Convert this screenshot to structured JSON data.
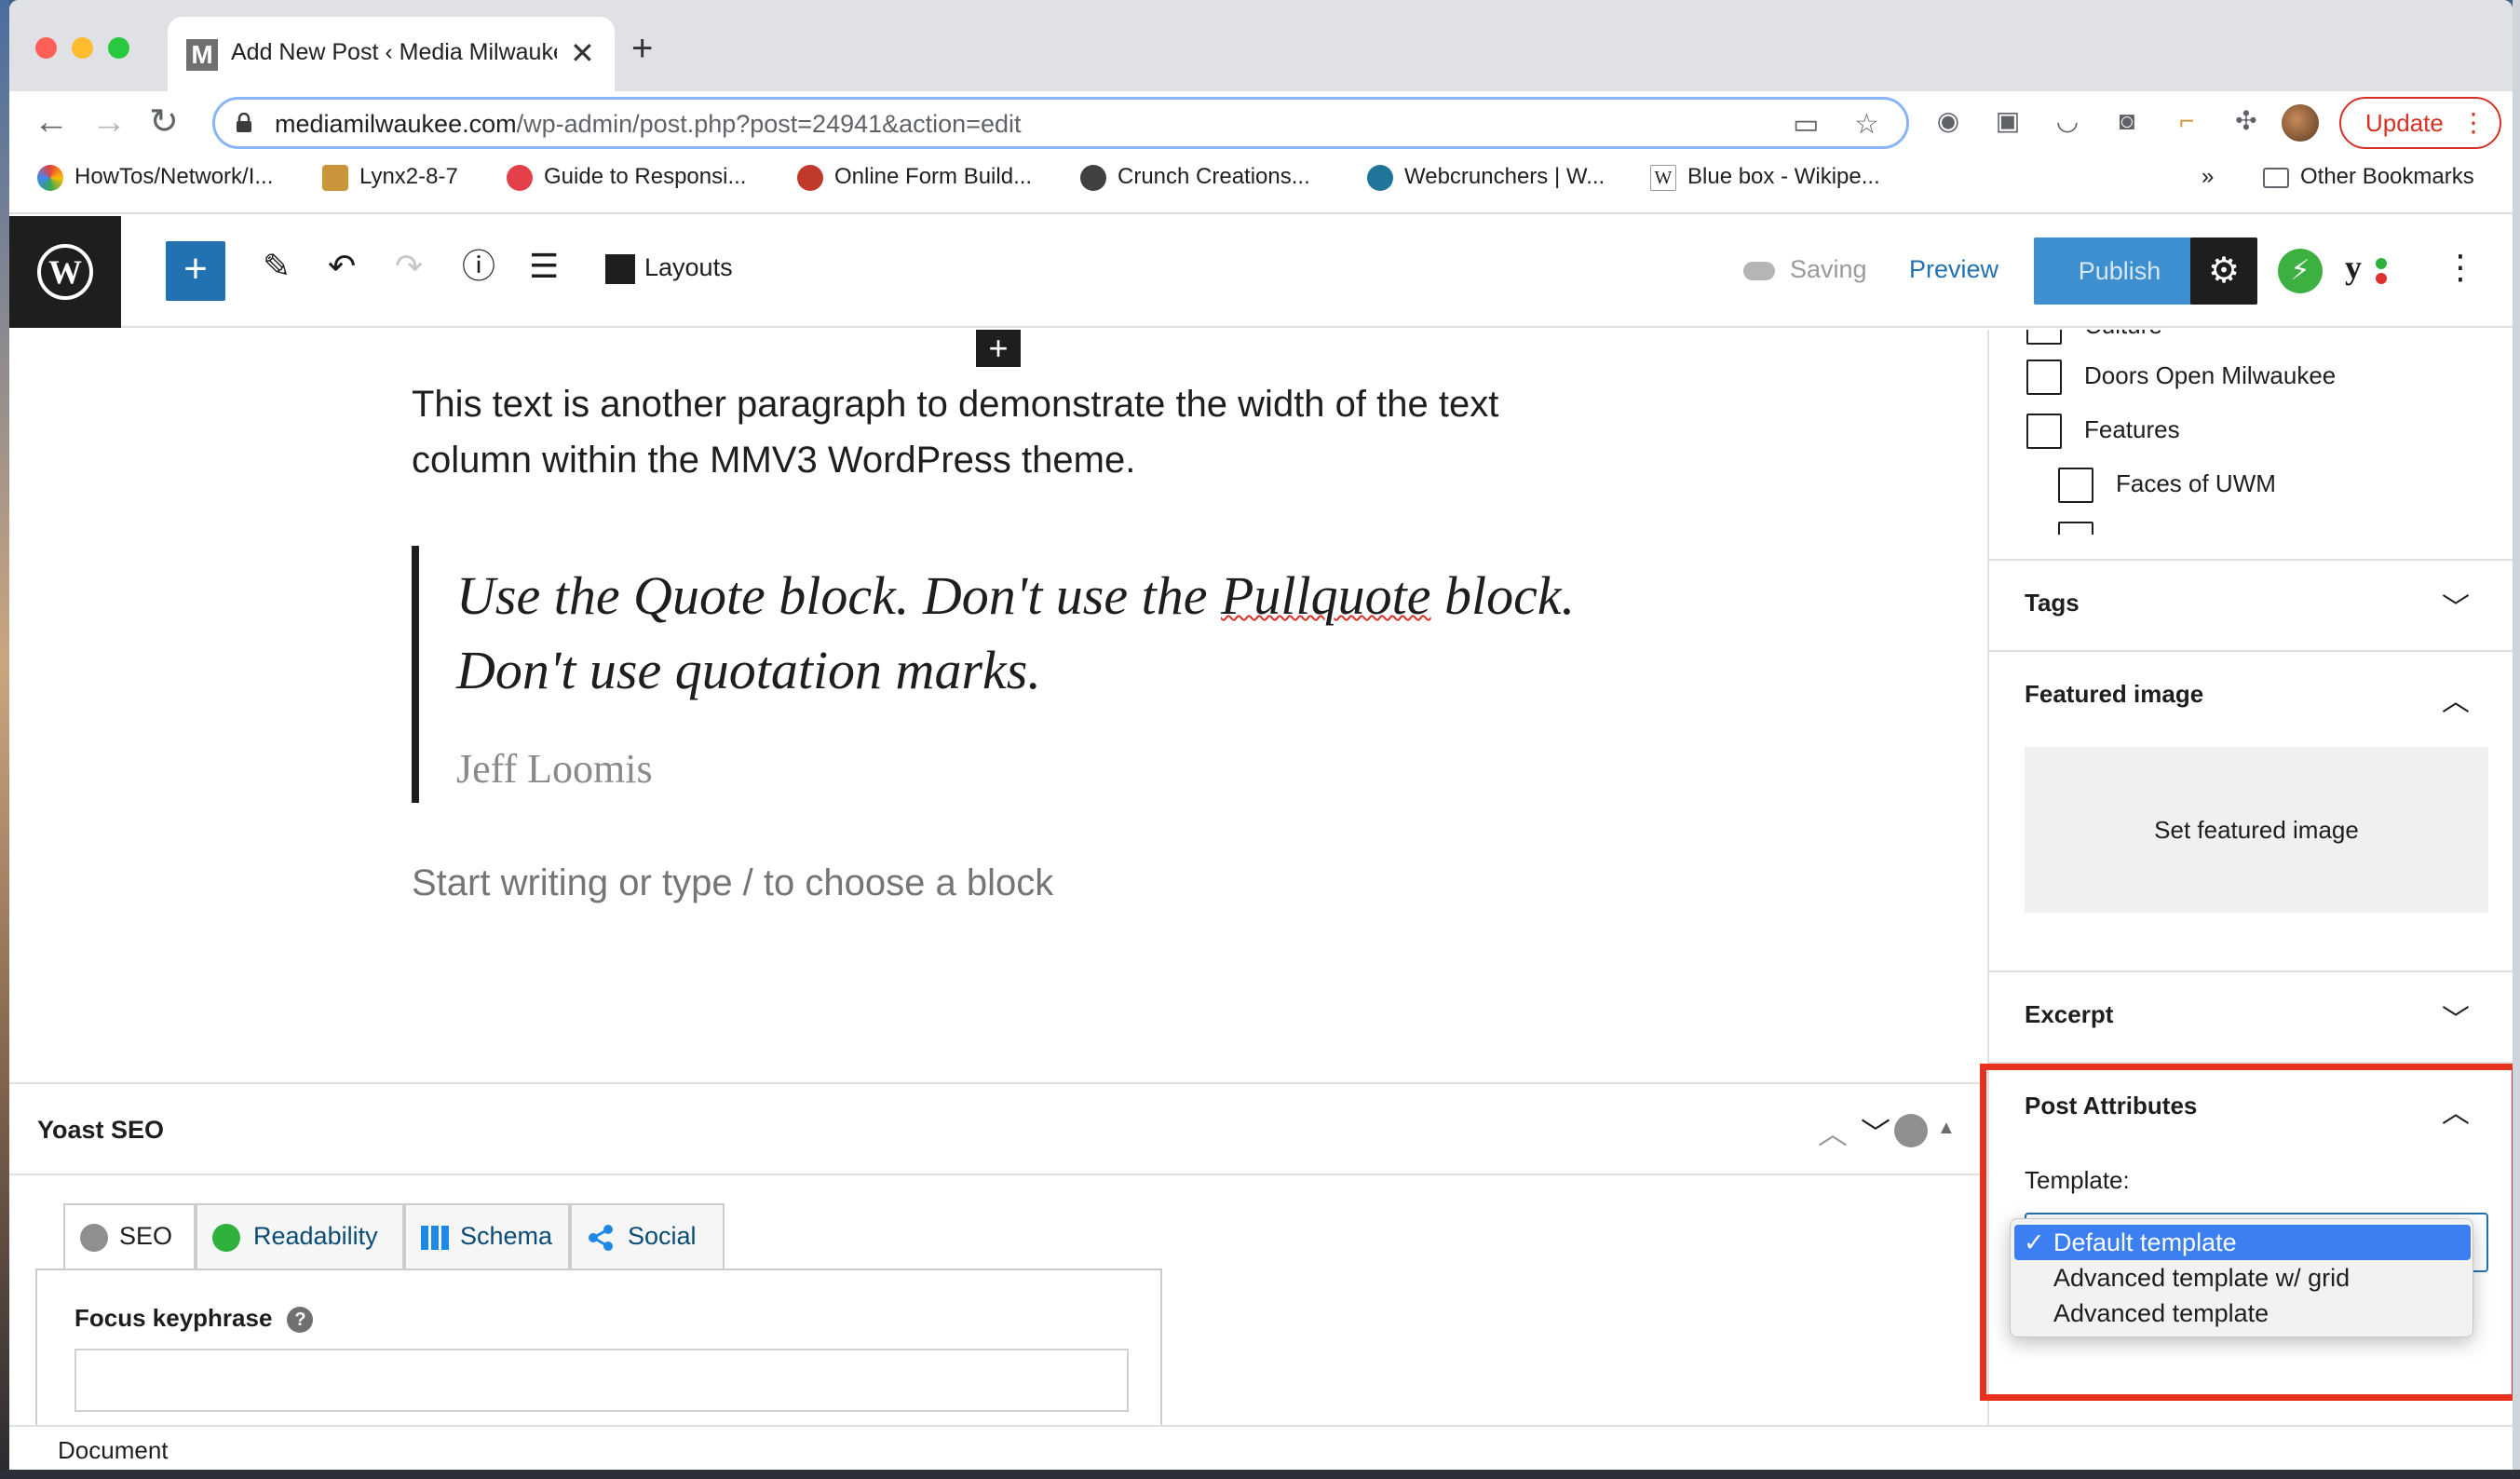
{
  "browser": {
    "tab_title": "Add New Post ‹ Media Milwaukee",
    "tab_favicon": "M",
    "tab_close": "✕",
    "new_tab": "+",
    "url_domain": "mediamilwaukee.com",
    "url_path": "/wp-admin/post.php?post=24941&action=edit",
    "update_label": "Update",
    "bookmarks": [
      {
        "label": "HowTos/Network/I...",
        "icon": "puzzle-colorful-icon"
      },
      {
        "label": "Lynx2-8-7",
        "icon": "lynx-icon"
      },
      {
        "label": "Guide to Responsi...",
        "icon": "guide-icon"
      },
      {
        "label": "Online Form Build...",
        "icon": "form-icon"
      },
      {
        "label": "Crunch Creations...",
        "icon": "crunch-icon"
      },
      {
        "label": "Webcrunchers | W...",
        "icon": "wordpress-icon"
      },
      {
        "label": "Blue box - Wikipe...",
        "icon": "wikipedia-icon"
      }
    ],
    "bookmarks_overflow": "»",
    "other_bookmarks": "Other Bookmarks"
  },
  "editor_header": {
    "layouts_label": "Layouts",
    "saving_label": "Saving",
    "preview_label": "Preview",
    "publish_label": "Publish"
  },
  "content": {
    "paragraph": "This text is another paragraph to demonstrate the width of the text column within the MMV3 WordPress theme.",
    "quote_before": "Use the Quote block. Don't use the ",
    "quote_misspelled": "Pullquote",
    "quote_after": " block. Don't use quotation marks.",
    "quote_citation": "Jeff Loomis",
    "placeholder": "Start writing or type / to choose a block"
  },
  "yoast": {
    "title": "Yoast SEO",
    "tabs": [
      {
        "label": "SEO",
        "icon": "score-circle-icon"
      },
      {
        "label": "Readability",
        "icon": "smiley-icon"
      },
      {
        "label": "Schema",
        "icon": "grid-icon"
      },
      {
        "label": "Social",
        "icon": "share-icon"
      }
    ],
    "focus_keyphrase_label": "Focus keyphrase",
    "focus_keyphrase_value": ""
  },
  "sidebar": {
    "categories": [
      {
        "label": "Culture",
        "checked": false
      },
      {
        "label": "Doors Open Milwaukee",
        "checked": false
      },
      {
        "label": "Features",
        "checked": false
      },
      {
        "label": "Faces of UWM",
        "checked": false
      }
    ],
    "panels": {
      "tags": "Tags",
      "featured_image": "Featured image",
      "set_featured_image": "Set featured image",
      "excerpt": "Excerpt",
      "post_attributes": "Post Attributes"
    },
    "template_label": "Template:",
    "template_options": [
      {
        "label": "Default template",
        "selected": true
      },
      {
        "label": "Advanced template w/ grid",
        "selected": false
      },
      {
        "label": "Advanced template",
        "selected": false
      }
    ],
    "check_mark": "✓"
  },
  "status_bar": {
    "breadcrumb": "Document"
  },
  "colors": {
    "wp_blue": "#2271b1",
    "publish_disabled": "#3e8fcf",
    "highlight_red": "#e8321e",
    "yoast_green": "#2fb13c",
    "selected_option": "#3b7ff3"
  }
}
